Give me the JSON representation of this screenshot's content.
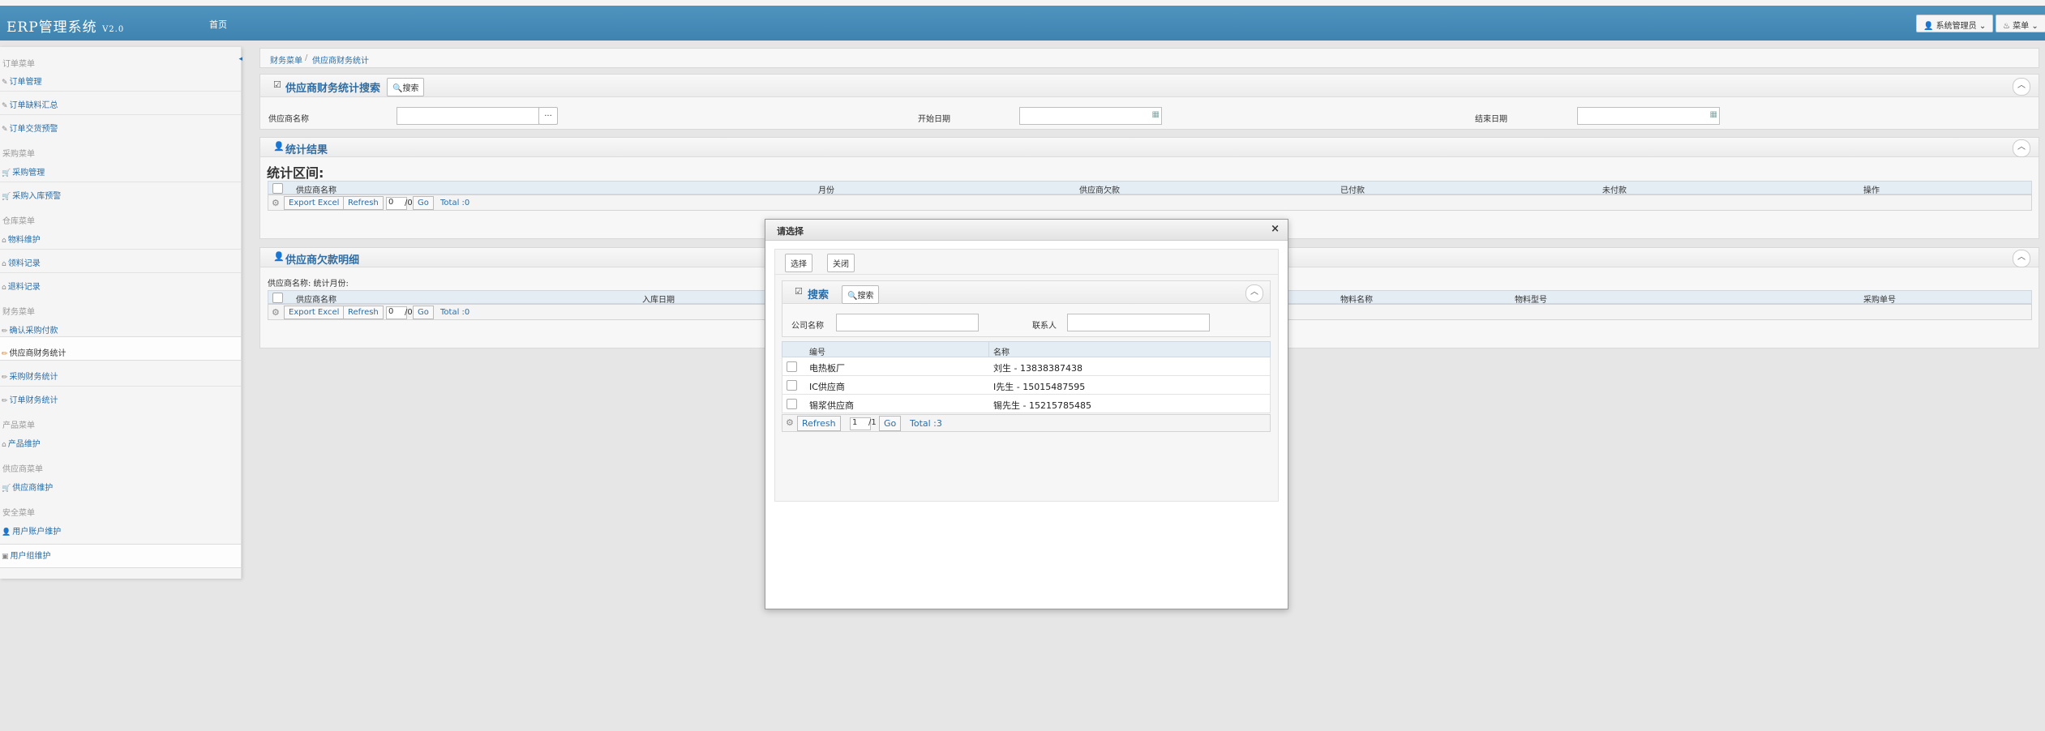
{
  "app": {
    "title": "ERP管理系统",
    "version": "V2.0",
    "home": "首页",
    "user_label": "系统管理员",
    "menu_label": "菜单"
  },
  "sidebar": {
    "groups": [
      {
        "title": "订单菜单",
        "items": [
          "订单管理",
          "订单缺料汇总",
          "订单交货预警"
        ]
      },
      {
        "title": "采购菜单",
        "items": [
          "采购管理",
          "采购入库预警"
        ]
      },
      {
        "title": "仓库菜单",
        "items": [
          "物料维护",
          "领料记录",
          "退料记录"
        ]
      },
      {
        "title": "财务菜单",
        "items": [
          "确认采购付款",
          "供应商财务统计",
          "采购财务统计",
          "订单财务统计"
        ]
      },
      {
        "title": "产品菜单",
        "items": [
          "产品维护"
        ]
      },
      {
        "title": "供应商菜单",
        "items": [
          "供应商维护"
        ]
      },
      {
        "title": "安全菜单",
        "items": [
          "用户账户维护",
          "用户组维护"
        ]
      }
    ]
  },
  "breadcrumb": {
    "root": "财务菜单",
    "sep": "/",
    "current": "供应商财务统计"
  },
  "search_panel": {
    "title": "供应商财务统计搜索",
    "search_btn": "搜索",
    "supplier_label": "供应商名称",
    "picker_btn": "...",
    "start_label": "开始日期",
    "end_label": "结束日期"
  },
  "stats_panel": {
    "title": "统计结果",
    "range_label": "统计区间:",
    "columns": [
      "供应商名称",
      "月份",
      "供应商欠款",
      "已付款",
      "未付款",
      "操作"
    ],
    "pager": {
      "export": "Export Excel",
      "refresh": "Refresh",
      "page": "0",
      "total_pages": "/0",
      "go": "Go",
      "total": "Total :0"
    }
  },
  "debt_panel": {
    "title": "供应商欠款明细",
    "info": "供应商名称: 统计月份:",
    "columns": [
      "供应商名称",
      "入库日期",
      "物料名称",
      "物料型号",
      "采购单号"
    ],
    "pager": {
      "export": "Export Excel",
      "refresh": "Refresh",
      "page": "0",
      "total_pages": "/0",
      "go": "Go",
      "total": "Total :0"
    }
  },
  "modal": {
    "title": "请选择",
    "close": "×",
    "select_btn": "选择",
    "close_btn": "关闭",
    "search_title": "搜索",
    "search_btn": "搜索",
    "company_label": "公司名称",
    "contact_label": "联系人",
    "columns": [
      "编号",
      "名称"
    ],
    "rows": [
      {
        "code": "电热板厂",
        "name": "刘生 - 13838387438"
      },
      {
        "code": "IC供应商",
        "name": "I先生 - 15015487595"
      },
      {
        "code": "锡浆供应商",
        "name": "锡先生 - 15215785485"
      }
    ],
    "pager": {
      "refresh": "Refresh",
      "page": "1",
      "total_pages": "/1",
      "go": "Go",
      "total": "Total :3"
    }
  },
  "colors": {
    "topbar": "#4a8fbb",
    "link": "#2e6da4",
    "grid_head": "#e4edf4"
  }
}
